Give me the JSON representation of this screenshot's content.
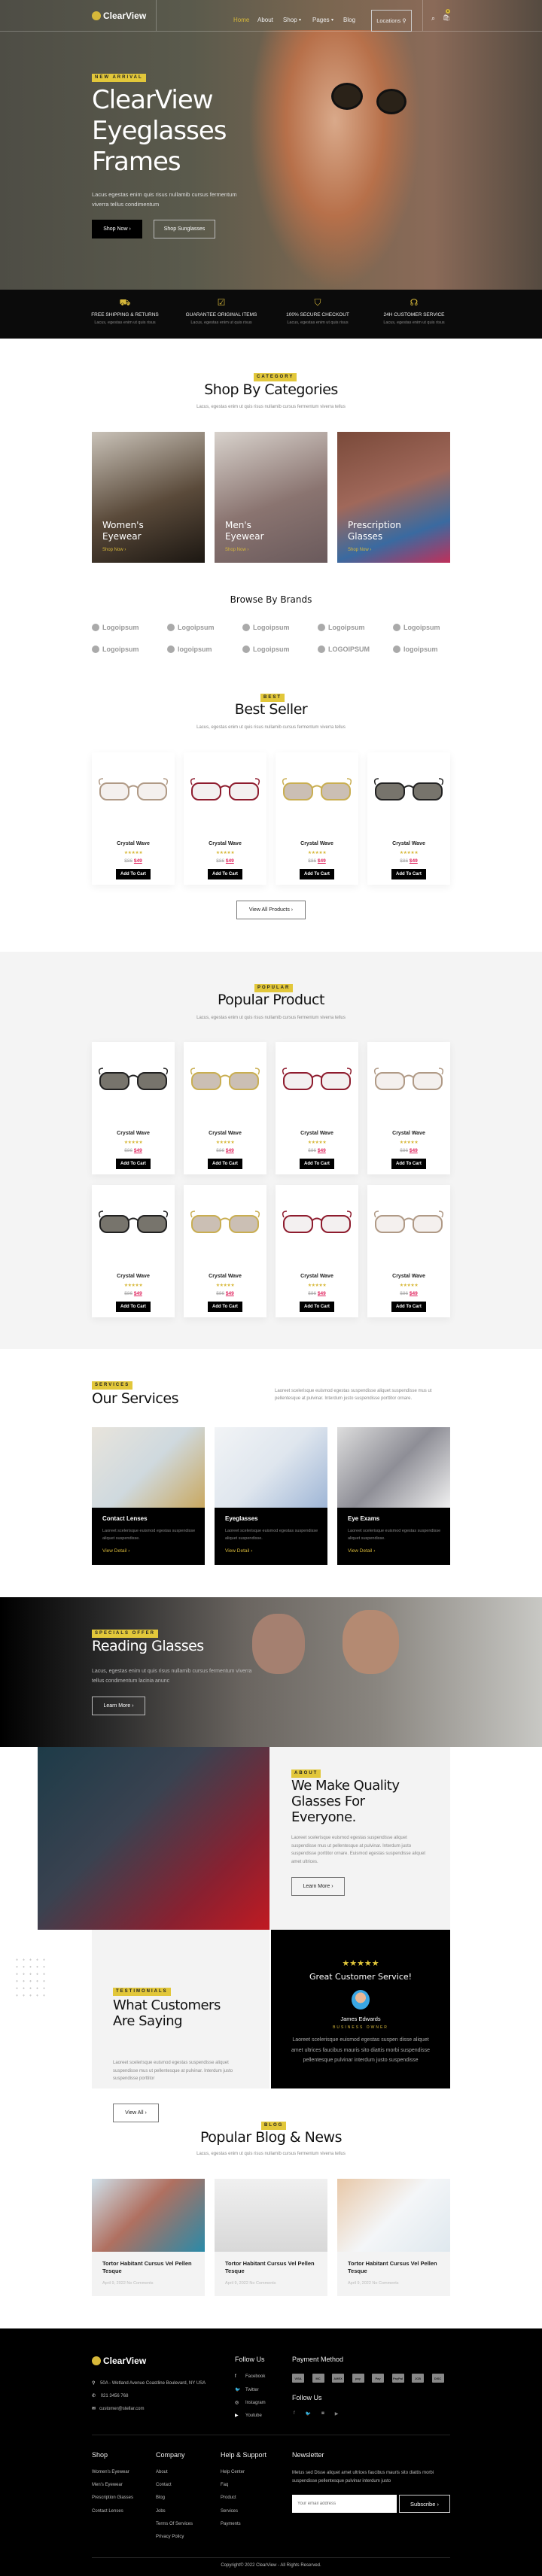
{
  "header": {
    "logo": "ClearView",
    "nav": [
      "Home",
      "About",
      "Shop",
      "Pages",
      "Blog"
    ],
    "locations": "Locations",
    "cart_count": "0",
    "active_color": "#d7b83a"
  },
  "hero": {
    "tag": "NEW ARRIVAL",
    "title_lines": [
      "ClearView",
      "Eyeglasses",
      "Frames"
    ],
    "text": "Lacus egestas enim quis risus nullamib cursus fermentum viverra tellus condimentum",
    "primary": "Shop Now",
    "secondary": "Shop Sunglasses"
  },
  "features": [
    {
      "icon": "truck-icon",
      "title": "FREE SHIPPING & RETURNS",
      "text": "Lacus, egestas enim ut quis risus"
    },
    {
      "icon": "checklist-icon",
      "title": "GUARANTEE ORIGINAL ITEMS",
      "text": "Lacus, egestas enim ut quis risus"
    },
    {
      "icon": "shield-check-icon",
      "title": "100% SECURE CHECKOUT",
      "text": "Lacus, egestas enim ut quis risus"
    },
    {
      "icon": "headset-icon",
      "title": "24H CUSTOMER SERVICE",
      "text": "Lacus, egestas enim ut quis risus"
    }
  ],
  "categories": {
    "tag": "CATEGORY",
    "title": "Shop By Categories",
    "subtitle": "Lacus, egestas enim ut quis risus nullamib cursus fermentum viverra tellus",
    "items": [
      {
        "title": "Women's Eyewear",
        "link": "Shop Now"
      },
      {
        "title": "Men's Eyewear",
        "link": "Shop Now"
      },
      {
        "title": "Prescription Glasses",
        "link": "Shop Now"
      }
    ]
  },
  "brands": {
    "title": "Browse By Brands",
    "items": [
      "Logoipsum",
      "Logoipsum",
      "Logoipsum",
      "Logoipsum",
      "Logoipsum",
      "Logoipsum",
      "logoipsum",
      "Logoipsum",
      "LOGOIPSUM",
      "logoipsum"
    ]
  },
  "best_seller": {
    "tag": "BEST",
    "title": "Best Seller",
    "subtitle": "Lacus, egestas enim ut quis risus nullamib cursus fermentum viverra tellus",
    "view_all": "View All Products",
    "products": [
      {
        "name": "Crystal Wave",
        "rating": 5,
        "old_price": "$86",
        "price": "$49",
        "add": "Add To Cart",
        "frame_color": "#b09a86",
        "lens_color": "#f4f0ee"
      },
      {
        "name": "Crystal Wave",
        "rating": 5,
        "old_price": "$86",
        "price": "$49",
        "add": "Add To Cart",
        "frame_color": "#8e1c2e",
        "lens_color": "#f3f0f0"
      },
      {
        "name": "Crystal Wave",
        "rating": 5,
        "old_price": "$86",
        "price": "$49",
        "add": "Add To Cart",
        "frame_color": "#c9ae52",
        "lens_color": "#cbbfb4"
      },
      {
        "name": "Crystal Wave",
        "rating": 5,
        "old_price": "$86",
        "price": "$49",
        "add": "Add To Cart",
        "frame_color": "#222222",
        "lens_color": "#77746c"
      }
    ]
  },
  "popular": {
    "tag": "POPULAR",
    "title": "Popular Product",
    "subtitle": "Lacus, egestas enim ut quis risus nullamib cursus fermentum viverra tellus",
    "products": [
      {
        "name": "Crystal Wave",
        "rating": 5,
        "old_price": "$86",
        "price": "$49",
        "add": "Add To Cart",
        "frame_color": "#222222",
        "lens_color": "#77746c"
      },
      {
        "name": "Crystal Wave",
        "rating": 5,
        "old_price": "$86",
        "price": "$49",
        "add": "Add To Cart",
        "frame_color": "#c9ae52",
        "lens_color": "#cbbfb4"
      },
      {
        "name": "Crystal Wave",
        "rating": 5,
        "old_price": "$86",
        "price": "$49",
        "add": "Add To Cart",
        "frame_color": "#8e1c2e",
        "lens_color": "#f3f0f0"
      },
      {
        "name": "Crystal Wave",
        "rating": 5,
        "old_price": "$86",
        "price": "$49",
        "add": "Add To Cart",
        "frame_color": "#b09a86",
        "lens_color": "#f4f0ee"
      },
      {
        "name": "Crystal Wave",
        "rating": 5,
        "old_price": "$86",
        "price": "$49",
        "add": "Add To Cart",
        "frame_color": "#222222",
        "lens_color": "#77746c"
      },
      {
        "name": "Crystal Wave",
        "rating": 5,
        "old_price": "$86",
        "price": "$49",
        "add": "Add To Cart",
        "frame_color": "#c9ae52",
        "lens_color": "#cbbfb4"
      },
      {
        "name": "Crystal Wave",
        "rating": 5,
        "old_price": "$86",
        "price": "$49",
        "add": "Add To Cart",
        "frame_color": "#8e1c2e",
        "lens_color": "#f3f0f0"
      },
      {
        "name": "Crystal Wave",
        "rating": 5,
        "old_price": "$86",
        "price": "$49",
        "add": "Add To Cart",
        "frame_color": "#b09a86",
        "lens_color": "#f4f0ee"
      }
    ]
  },
  "services": {
    "tag": "SERVICES",
    "title": "Our Services",
    "description": "Laoreet scelerisque euismod egestas suspendisse aliquet suspendisse mus ut pellentesque at pulvinar. Interdum justo suspendisse porttitor ornare.",
    "items": [
      {
        "title": "Contact Lenses",
        "text": "Laoreet scelerisque euismod egestas suspendisse aliquet suspendisse.",
        "link": "View Detail"
      },
      {
        "title": "Eyeglasses",
        "text": "Laoreet scelerisque euismod egestas suspendisse aliquet suspendisse.",
        "link": "View Detail"
      },
      {
        "title": "Eye Exams",
        "text": "Laoreet scelerisque euismod egestas suspendisse aliquet suspendisse.",
        "link": "View Detail"
      }
    ]
  },
  "offer": {
    "tag": "SPECIALS OFFER",
    "title": "Reading Glasses",
    "text": "Lacus, egestas enim ut quis risus nullamib cursus fermentum viverra tellus condimentum lacinia anunc",
    "button": "Learn More"
  },
  "about": {
    "tag": "ABOUT",
    "title": "We Make Quality Glasses For Everyone.",
    "text": "Laoreet scelerisque euismod egestas suspendisse aliquet suspendisse mus ut pellentesque at pulvinar. Interdum justo suspendisse porttitor ornare. Euismod egestas suspendisse aliquet amet ultrices.",
    "button": "Learn More"
  },
  "testimonials": {
    "tag": "TESTIMONIALS",
    "title": "What Customers Are Saying",
    "text": "Laoreet scelerisque euismod egestas suspendisse aliquet suspendisse mus ut pellentesque at pulvinar. Interdum justo suspendisse porttitor",
    "button": "View All",
    "review": {
      "rating": 5,
      "headline": "Great Customer Service!",
      "name": "James Edwards",
      "role": "BUSINESS OWNER",
      "text": "Laoreet scelerisque euismod egestas suspen disse aliquet amet ultrices faucibus mauris sito diattis morbi suspendisse pellentesque pulvinar interdum justo suspendisse"
    }
  },
  "blog": {
    "tag": "BLOG",
    "title": "Popular Blog & News",
    "subtitle": "Lacus, egestas enim ut quis risus nullamib cursus fermentum viverra tellus",
    "posts": [
      {
        "title": "Tortor Habitant Cursus Vel Pellen Tesque",
        "meta": "April 9, 2022 No Comments"
      },
      {
        "title": "Tortor Habitant Cursus Vel Pellen Tesque",
        "meta": "April 9, 2022 No Comments"
      },
      {
        "title": "Tortor Habitant Cursus Vel Pellen Tesque",
        "meta": "April 9, 2022 No Comments"
      }
    ]
  },
  "footer": {
    "logo": "ClearView",
    "address": "50A - Wetland Avenue Coastline Boulevard, NY USA",
    "phone": "021 3456 768",
    "email": "customer@stellar.com",
    "follow_title": "Follow Us",
    "social": [
      "Facebook",
      "Twitter",
      "Instagram",
      "Youtube"
    ],
    "payment_title": "Payment Method",
    "payments": [
      "VISA",
      "MC",
      "AMEX",
      "pay",
      "Pay",
      "PayPal",
      "JCB",
      "DISC"
    ],
    "follow_title2": "Follow Us",
    "shop": {
      "title": "Shop",
      "links": [
        "Women's Eyewear",
        "Men's Eyewear",
        "Prescription Glasses",
        "Contact Lenses"
      ]
    },
    "company": {
      "title": "Company",
      "links": [
        "About",
        "Contact",
        "Blog",
        "Jobs",
        "Terms Of Services",
        "Privacy Policy"
      ]
    },
    "help": {
      "title": "Help & Support",
      "links": [
        "Help Center",
        "Faq",
        "Product",
        "Services",
        "Payments"
      ]
    },
    "newsletter": {
      "title": "Newsletter",
      "text": "Metus sed Disse aliquet amet ultrices faucibus mauris sito diattis morbi suspendisse pellentesque pulvinar interdum justo",
      "placeholder": "Your email address",
      "button": "Subscribe"
    },
    "copyright": "Copyright© 2022 ClearView - All Rights Reserved."
  }
}
